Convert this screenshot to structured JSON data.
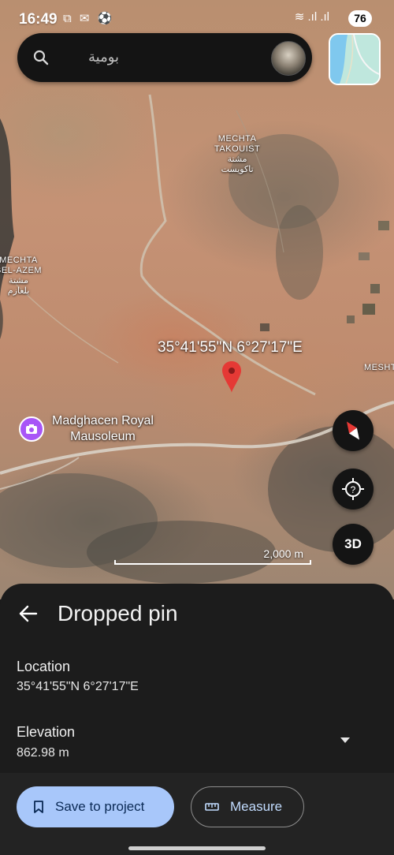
{
  "status_bar": {
    "time": "16:49",
    "left_icons": "⧉ ✉ ⚽",
    "right_icons": "≋ .ıl .ıl",
    "battery": "76"
  },
  "search": {
    "placeholder": "بومية",
    "icon": "search-icon"
  },
  "map": {
    "labels": [
      {
        "text": "MECHTA\nTAKOUIST\nمشتة\nتاكويست"
      },
      {
        "text": "MECHTA\nBEL-AZEM\nمشتة\nبلعازم"
      },
      {
        "text": "MESHT"
      }
    ],
    "coordinates_label": "35°41'55\"N 6°27'17\"E",
    "poi": {
      "label": "Madghacen Royal\nMausoleum",
      "icon": "camera-icon",
      "color": "#a855f7"
    },
    "scale_label": "2,000 m",
    "pin_color": "#e53935",
    "buttons": {
      "compass": "compass-icon",
      "locate": "location-help-icon",
      "three_d": "3D"
    }
  },
  "sheet": {
    "title": "Dropped pin",
    "location_label": "Location",
    "location_value": "35°41'55\"N 6°27'17\"E",
    "elevation_label": "Elevation",
    "elevation_value": "862.98 m"
  },
  "actions": {
    "save_label": "Save to project",
    "measure_label": "Measure"
  },
  "colors": {
    "save_bg": "#a8c7fa",
    "sheet_bg": "#1c1c1c"
  }
}
